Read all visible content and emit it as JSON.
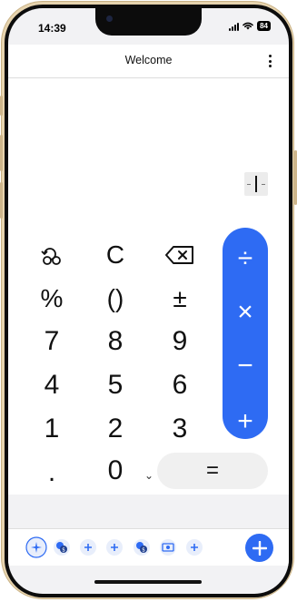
{
  "status_bar": {
    "time": "14:39",
    "battery": "84"
  },
  "header": {
    "title": "Welcome",
    "menu_icon": "more-vertical-icon"
  },
  "display": {
    "value": ""
  },
  "keypad": {
    "history_icon": "history-icon",
    "clear": "C",
    "backspace_icon": "backspace-icon",
    "percent": "%",
    "parentheses": "()",
    "plus_minus": "±",
    "digits": {
      "seven": "7",
      "eight": "8",
      "nine": "9",
      "four": "4",
      "five": "5",
      "six": "6",
      "one": "1",
      "two": "2",
      "three": "3",
      "zero": "0"
    },
    "decimal": ".",
    "equals": "=",
    "expand_icon": "chevron-down-icon"
  },
  "operators": {
    "divide": "÷",
    "multiply": "×",
    "subtract": "−",
    "add": "+"
  },
  "toolbar": {
    "items": [
      "sparkle-icon",
      "currency-convert-icon",
      "add-icon",
      "add-icon",
      "currency-convert-icon",
      "card-currency-icon",
      "add-icon"
    ],
    "fab_icon": "plus-icon"
  },
  "colors": {
    "accent": "#2e6bf3",
    "toolbar_icon_bg": "#e8eefb",
    "frame_gold": "#e6d3ae"
  }
}
